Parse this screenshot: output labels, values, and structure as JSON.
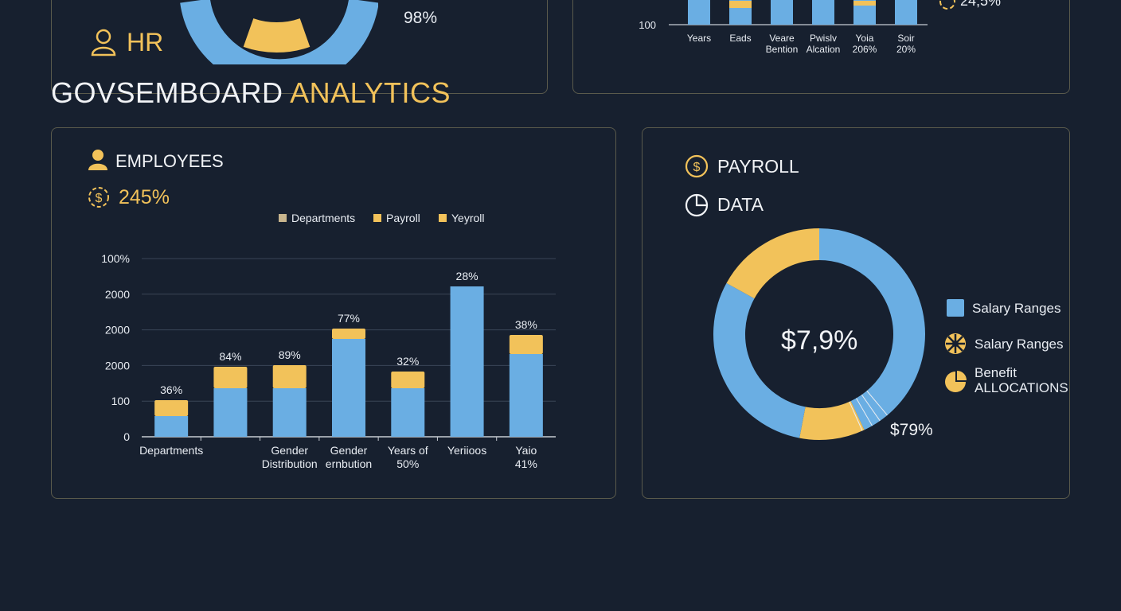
{
  "colors": {
    "background": "#17202f",
    "blue": "#6aaee3",
    "gold": "#f2c25a",
    "text": "#e9edf3",
    "border": "#5a5a4c"
  },
  "top_left": {
    "label": "HR",
    "value": "98%",
    "icon": "user-icon"
  },
  "title": {
    "part1": "GOVSEMBOARD",
    "part2": "ANALYTICS"
  },
  "top_right": {
    "corner_value": "24,5%",
    "ytick": "100",
    "labels": [
      [
        "Years"
      ],
      [
        "Eads"
      ],
      [
        "Veare",
        "Bention"
      ],
      [
        "Pwislv",
        "Alcation"
      ],
      [
        "Yoia",
        "206%"
      ],
      [
        "Soir",
        "20%"
      ]
    ]
  },
  "employees": {
    "title": "EMPLOYEES",
    "metric": "245%",
    "legend": [
      "Departments",
      "Payroll",
      "Yeyroll"
    ],
    "legend_colors": [
      "#c8b58e",
      "#f2c25a",
      "#f2c25a"
    ]
  },
  "payroll": {
    "title1": "PAYROLL",
    "title2": "DATA",
    "center_value": "$7,9%",
    "outer_value": "$79%",
    "legend": [
      {
        "label1": "Salary Ranges",
        "label2": "",
        "icon": "square-icon"
      },
      {
        "label1": "Salary Ranges",
        "label2": "",
        "icon": "starburst-icon"
      },
      {
        "label1": "Benefit",
        "label2": "ALLOCATIONS",
        "icon": "pie-icon"
      }
    ]
  },
  "chart_data": [
    {
      "type": "bar",
      "title": "EMPLOYEES",
      "yticks": [
        "100%",
        "2000",
        "2000",
        "2000",
        "100",
        "0"
      ],
      "categories": [
        [
          "Departments"
        ],
        [
          ""
        ],
        [
          "Gender",
          "Distribution"
        ],
        [
          "Gender",
          "ernbution"
        ],
        [
          "Years of",
          "50%"
        ],
        [
          "Yeriioos"
        ],
        [
          "Yaio",
          "41%"
        ]
      ],
      "series": [
        {
          "name": "Departments",
          "values": [
            26,
            61,
            61,
            123,
            61,
            189,
            104
          ]
        },
        {
          "name": "Payroll",
          "values": [
            20,
            27,
            29,
            13,
            21,
            0,
            24
          ]
        }
      ],
      "data_labels": [
        "36%",
        "84%",
        "89%",
        "77%",
        "32%",
        "28%",
        "38%"
      ]
    },
    {
      "type": "pie",
      "title": "PAYROLL DATA",
      "segments": [
        {
          "value": 43
        },
        {
          "value": 10
        },
        {
          "value": 30
        },
        {
          "value": 17
        }
      ]
    }
  ]
}
